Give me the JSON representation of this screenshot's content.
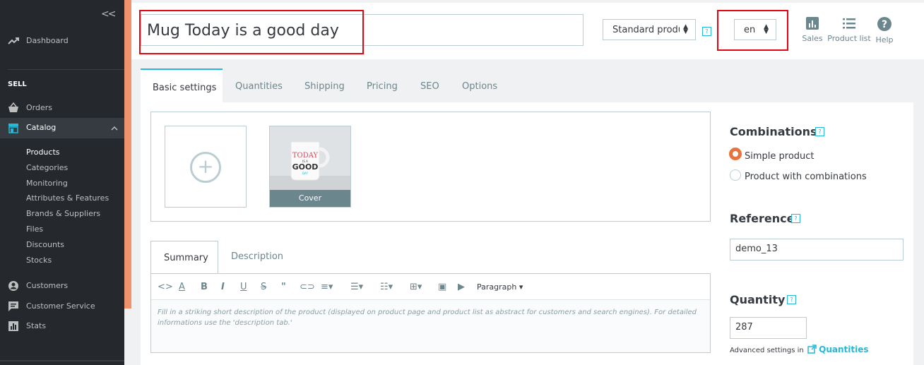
{
  "sidebar": {
    "collapse_glyph": "<<",
    "dashboard": "Dashboard",
    "sell_label": "SELL",
    "orders": "Orders",
    "catalog": "Catalog",
    "catalog_items": [
      "Products",
      "Categories",
      "Monitoring",
      "Attributes & Features",
      "Brands & Suppliers",
      "Files",
      "Discounts",
      "Stocks"
    ],
    "customers": "Customers",
    "customer_service": "Customer Service",
    "stats": "Stats"
  },
  "header": {
    "product_name": "Mug Today is a good day",
    "product_type": "Standard product",
    "language": "en",
    "help_mark": "?",
    "buttons": {
      "sales": "Sales",
      "product_list": "Product list",
      "help": "Help"
    }
  },
  "tabs": [
    "Basic settings",
    "Quantities",
    "Shipping",
    "Pricing",
    "SEO",
    "Options"
  ],
  "images": {
    "cover_label": "Cover",
    "mug_text": [
      "TODAY",
      "IS A",
      "GOOD",
      "DAY"
    ]
  },
  "editor": {
    "tabs": [
      "Summary",
      "Description"
    ],
    "format_select": "Paragraph",
    "placeholder": "Fill in a striking short description of the product (displayed on product page and product list as abstract for customers and search engines). For detailed informations use the 'description tab.'"
  },
  "right": {
    "combinations_title": "Combinations",
    "simple_product": "Simple product",
    "product_with_combinations": "Product with combinations",
    "reference_title": "Reference",
    "reference_value": "demo_13",
    "quantity_title": "Quantity",
    "quantity_value": "287",
    "advanced_settings_text": "Advanced settings in",
    "quantities_link": "Quantities"
  },
  "colors": {
    "accent": "#25b9d7",
    "brand_orange": "#f0936c",
    "radio_orange": "#e7743d",
    "highlight_red": "#e30613"
  }
}
